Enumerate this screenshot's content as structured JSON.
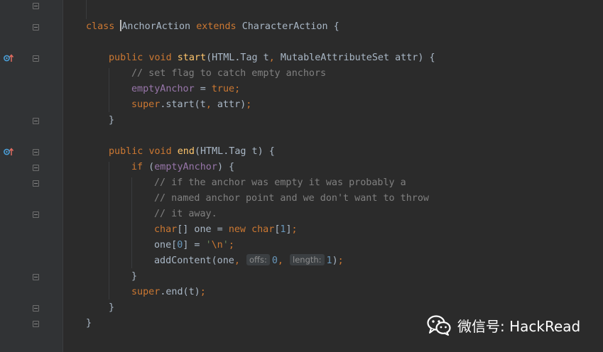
{
  "colors": {
    "background": "#2b2b2b",
    "keyword": "#cc7832",
    "field": "#9876aa",
    "method": "#ffc66d",
    "comment": "#808080",
    "number": "#6897bb",
    "string": "#6a8759",
    "text": "#a9b7c6"
  },
  "code": {
    "l1": {
      "kw": "class",
      "name": "AnchorAction",
      "ext": "extends",
      "parent": "CharacterAction {"
    },
    "l3": {
      "kw1": "public",
      "kw2": "void",
      "fn": "start",
      "a": "(HTML.Tag t",
      "comma": ",",
      "b": " MutableAttributeSet attr) {"
    },
    "l4": {
      "comment": "// set flag to catch empty anchors"
    },
    "l5": {
      "field": "emptyAnchor",
      "eq": " = ",
      "val": "true",
      "semi": ";"
    },
    "l6": {
      "kw": "super",
      "call": ".start(t",
      "comma": ",",
      "rest": " attr)",
      "semi": ";"
    },
    "l7": {
      "brace": "}"
    },
    "l9": {
      "kw1": "public",
      "kw2": "void",
      "fn": "end",
      "rest": "(HTML.Tag t) {"
    },
    "l10": {
      "kw": "if",
      "open": " (",
      "field": "emptyAnchor",
      "close": ") {"
    },
    "l11": {
      "comment": "// if the anchor was empty it was probably a"
    },
    "l12": {
      "comment": "// named anchor point and we don't want to throw"
    },
    "l13": {
      "comment": "// it away."
    },
    "l14": {
      "type": "char",
      "mid": "[] one = ",
      "kw": "new",
      "type2": "char",
      "lb": "[",
      "num": "1",
      "rb": "]",
      "semi": ";"
    },
    "l15": {
      "a": "one[",
      "num": "0",
      "b": "] = ",
      "q1": "'",
      "esc": "\\n",
      "q2": "'",
      "semi": ";"
    },
    "l16": {
      "call": "addContent(one",
      "c1": ",",
      "hint1": "offs:",
      "n1": "0",
      "c2": ",",
      "hint2": "length:",
      "n2": "1",
      "close": ")",
      "semi": ";"
    },
    "l17": {
      "brace": "}"
    },
    "l18": {
      "kw": "super",
      "call": ".end(t)",
      "semi": ";"
    },
    "l19": {
      "brace": "}"
    },
    "l20": {
      "brace": "}"
    }
  },
  "gutter": {
    "override_icons": [
      "override-implements-icon",
      "override-implements-icon"
    ]
  },
  "watermark": {
    "text": "微信号: HackRead",
    "icon": "wechat-icon"
  }
}
